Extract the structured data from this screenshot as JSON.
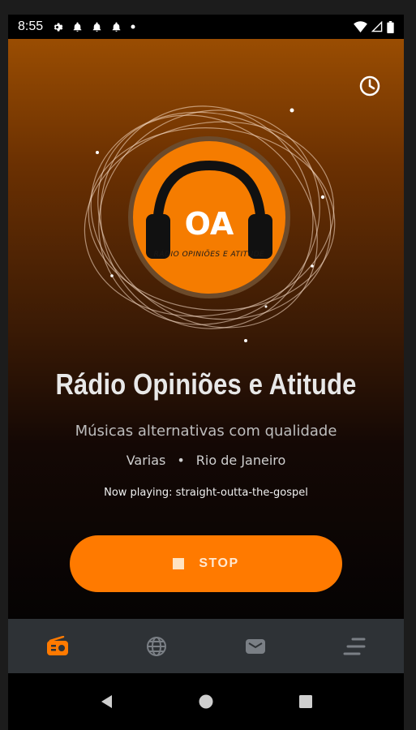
{
  "status_bar": {
    "time": "8:55"
  },
  "station": {
    "title": "Rádio Opiniões e Atitude",
    "subtitle": "Músicas alternativas com qualidade",
    "genre": "Varias",
    "separator": "•",
    "location": "Rio de Janeiro",
    "now_playing": "Now playing: straight-outta-the-gospel"
  },
  "logo": {
    "initials": "OA",
    "caption": "RÁDIO OPINIÕES E ATITUDE"
  },
  "controls": {
    "stop_label": "STOP"
  },
  "bottom_nav": [
    {
      "icon": "radio-icon",
      "active": true
    },
    {
      "icon": "globe-icon",
      "active": false
    },
    {
      "icon": "mail-icon",
      "active": false
    },
    {
      "icon": "menu-icon",
      "active": false
    }
  ],
  "colors": {
    "accent": "#ff7a00",
    "nav_active": "#ff7a00",
    "nav_inactive": "#7a7f85",
    "nav_bg": "#2e3236"
  }
}
